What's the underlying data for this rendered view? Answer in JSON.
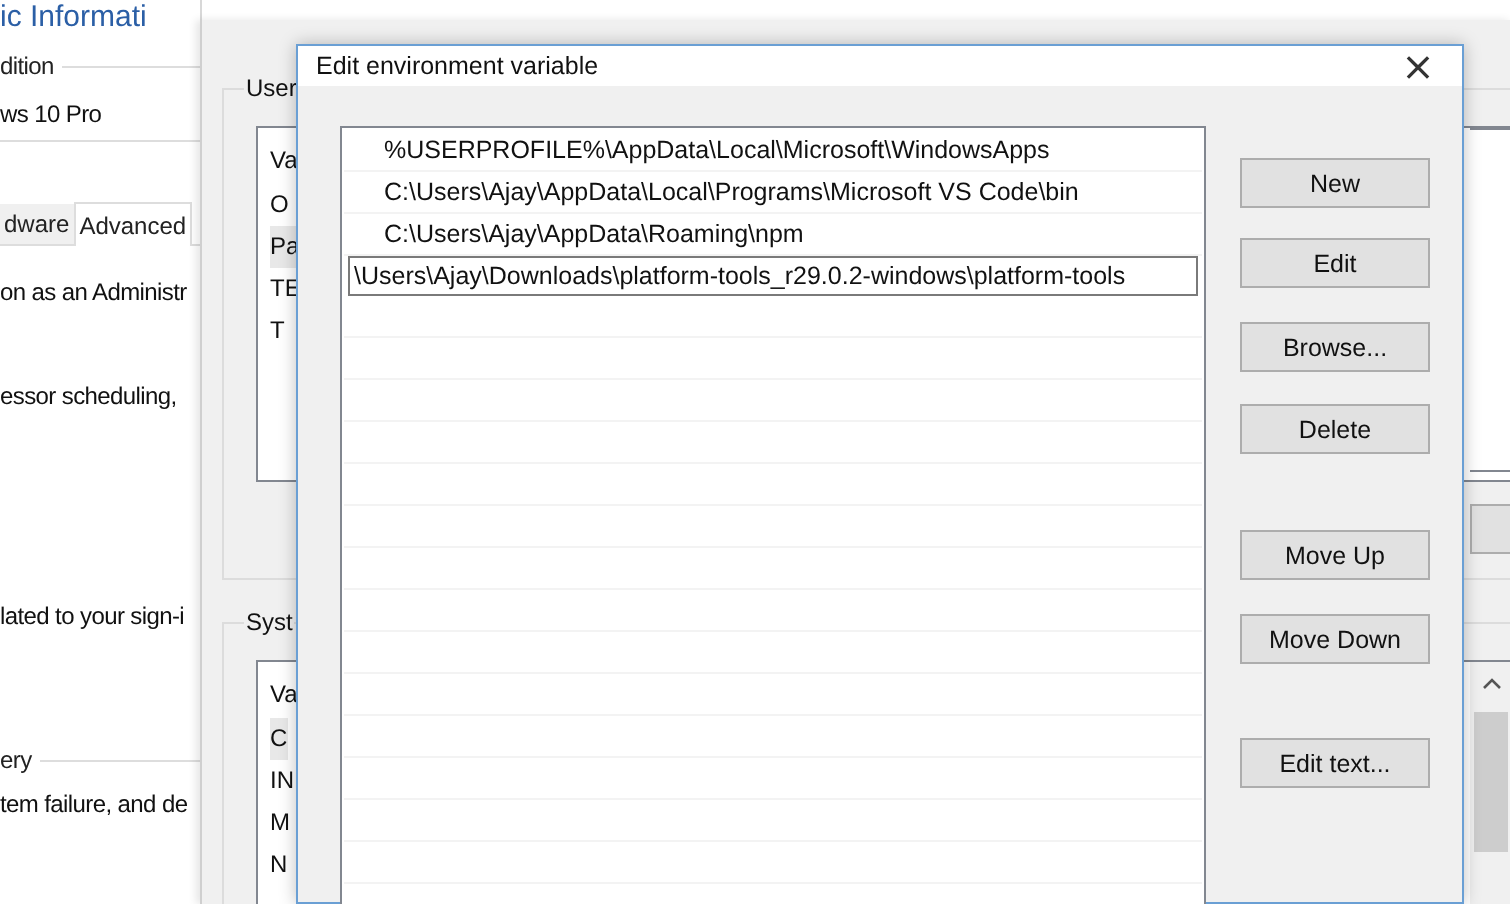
{
  "system_window": {
    "title": "ic Informati",
    "edition_label": "dition",
    "edition": "ws 10 Pro",
    "tabs": [
      {
        "label": "dware",
        "selected": false
      },
      {
        "label": "Advanced",
        "selected": true
      }
    ],
    "lines": [
      {
        "kind": "text",
        "text": "on as an Administr"
      },
      {
        "kind": "text",
        "text": "essor scheduling,"
      },
      {
        "kind": "text",
        "text": "lated to your sign-i"
      },
      {
        "kind": "group",
        "text": "ery"
      },
      {
        "kind": "text",
        "text": "tem failure, and de"
      }
    ]
  },
  "environment_window": {
    "groups": [
      {
        "label": "User",
        "header": "Va",
        "rows": [
          {
            "text": "O",
            "selected": false
          },
          {
            "text": "Pa",
            "selected": true
          },
          {
            "text": "TE",
            "selected": false
          },
          {
            "text": "T",
            "selected": false
          }
        ]
      },
      {
        "label": "Syst",
        "header": "Va",
        "rows": [
          {
            "text": "C",
            "selected": true
          },
          {
            "text": "IN",
            "selected": false
          },
          {
            "text": "M",
            "selected": false
          },
          {
            "text": "N",
            "selected": false
          }
        ]
      }
    ]
  },
  "dialog": {
    "title": "Edit environment variable",
    "close": "×",
    "paths": [
      {
        "text": "%USERPROFILE%\\AppData\\Local\\Microsoft\\WindowsApps",
        "editing": false
      },
      {
        "text": "C:\\Users\\Ajay\\AppData\\Local\\Programs\\Microsoft VS Code\\bin",
        "editing": false
      },
      {
        "text": "C:\\Users\\Ajay\\AppData\\Roaming\\npm",
        "editing": false
      },
      {
        "text": "\\Users\\Ajay\\Downloads\\platform-tools_r29.0.2-windows\\platform-tools",
        "editing": true
      }
    ],
    "buttons": [
      "New",
      "Edit",
      "Browse...",
      "Delete",
      "Move Up",
      "Move Down",
      "Edit text..."
    ]
  }
}
